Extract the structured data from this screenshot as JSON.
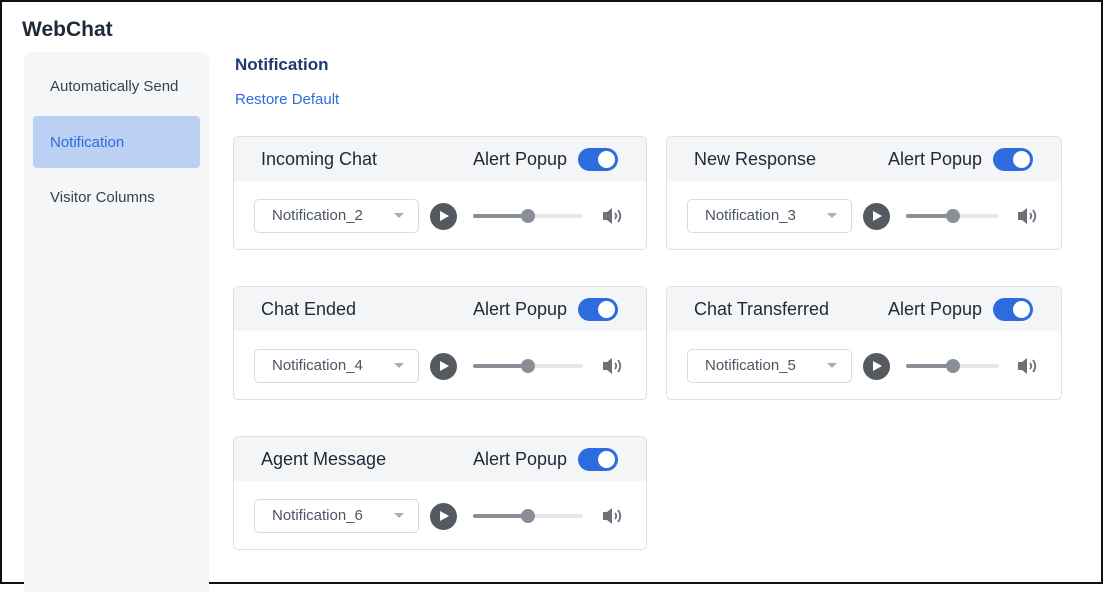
{
  "app": {
    "title": "WebChat"
  },
  "sidebar": {
    "items": [
      {
        "label": "Automatically Send",
        "active": false
      },
      {
        "label": "Notification",
        "active": true
      },
      {
        "label": "Visitor Columns",
        "active": false
      }
    ]
  },
  "main": {
    "title": "Notification",
    "restore_label": "Restore Default",
    "cards": [
      {
        "name": "Incoming Chat",
        "alert_label": "Alert Popup",
        "alert_on": true,
        "sound": "Notification_2",
        "volume": 0.5
      },
      {
        "name": "New Response",
        "alert_label": "Alert Popup",
        "alert_on": true,
        "sound": "Notification_3",
        "volume": 0.5
      },
      {
        "name": "Chat Ended",
        "alert_label": "Alert Popup",
        "alert_on": true,
        "sound": "Notification_4",
        "volume": 0.5
      },
      {
        "name": "Chat Transferred",
        "alert_label": "Alert Popup",
        "alert_on": true,
        "sound": "Notification_5",
        "volume": 0.5
      },
      {
        "name": "Agent Message",
        "alert_label": "Alert Popup",
        "alert_on": true,
        "sound": "Notification_6",
        "volume": 0.5
      }
    ]
  },
  "colors": {
    "accent": "#2d6cdf",
    "active_bg": "#bcd0f3",
    "title_navy": "#1e3a70"
  },
  "icons": {
    "play": "play-icon",
    "speaker": "volume-icon",
    "caret": "chevron-down-icon"
  }
}
